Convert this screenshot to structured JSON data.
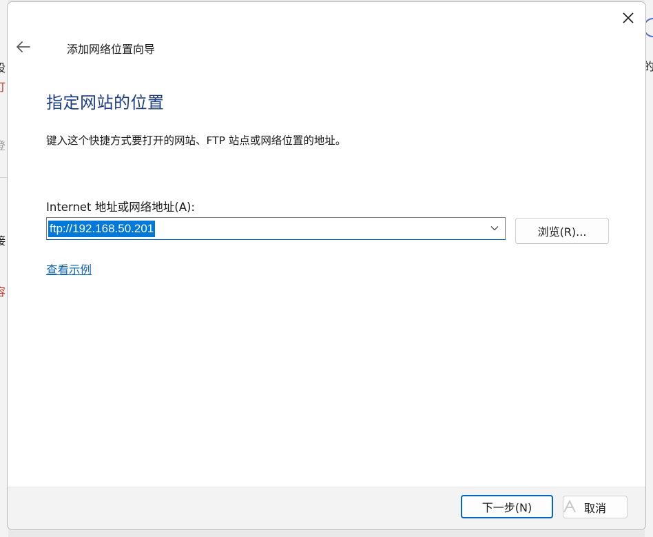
{
  "background": {
    "left_fragments": [
      {
        "text": "设",
        "color": "#1a1a1a"
      },
      {
        "text": "打",
        "color": "#c0392b"
      },
      {
        "text": "登",
        "color": "#9a9a9a"
      },
      {
        "text": "接",
        "color": "#1a1a1a"
      },
      {
        "text": "容",
        "color": "#c0392b"
      }
    ],
    "right_fragments": [
      {
        "text": "的",
        "color": "#1a1a1a"
      }
    ]
  },
  "dialog": {
    "wizard_title": "添加网络位置向导",
    "heading": "指定网站的位置",
    "instruction": "键入这个快捷方式要打开的网站、FTP 站点或网络位置的地址。",
    "address_label": "Internet 地址或网络地址(A):",
    "address_value": "ftp://192.168.50.201",
    "browse_label": "浏览(R)...",
    "example_link": "查看示例",
    "next_label": "下一步(N)",
    "cancel_label": "取消"
  },
  "icons": {
    "close": "close-icon",
    "back": "arrow-left-icon",
    "dropdown": "chevron-down-icon"
  },
  "colors": {
    "heading": "#1d3f82",
    "link": "#1467b3",
    "selection": "#0078d7",
    "focus_border": "#0067c0"
  }
}
